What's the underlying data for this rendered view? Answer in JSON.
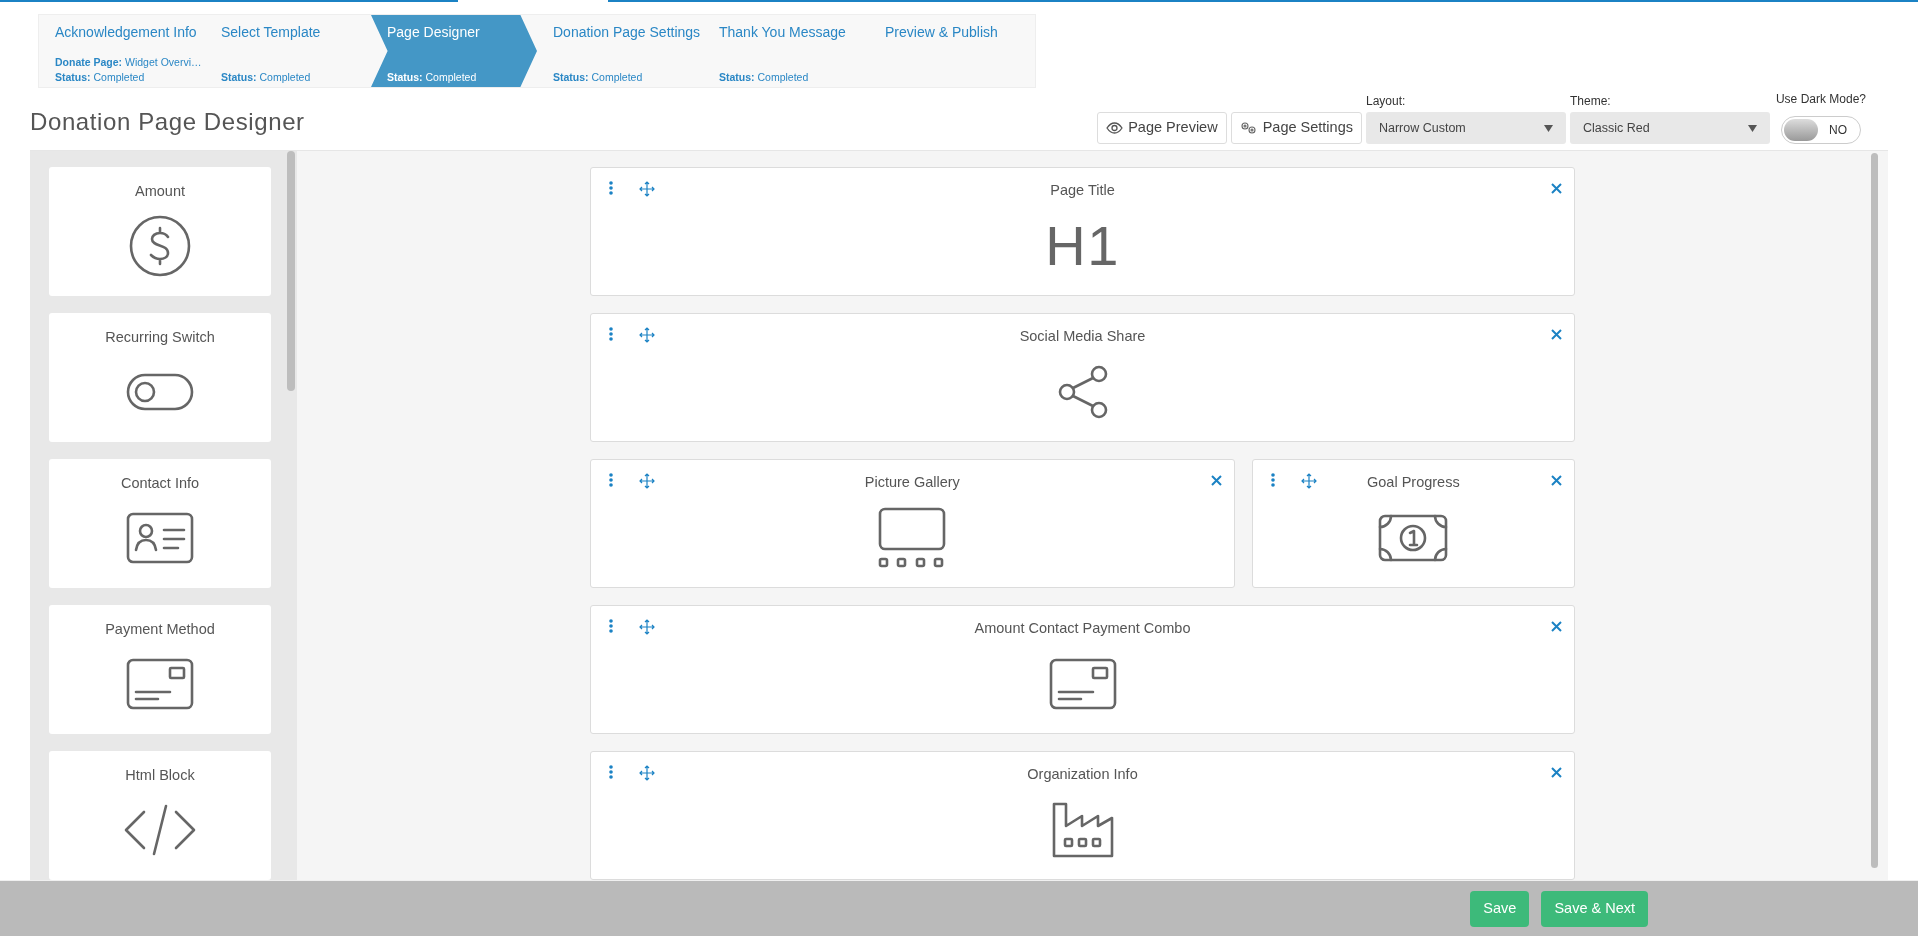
{
  "steps": [
    {
      "title": "Acknowledgement Info",
      "detail_label": "Donate Page:",
      "detail_value": "Widget Overvi…",
      "status_label": "Status:",
      "status_value": "Completed",
      "selected": false
    },
    {
      "title": "Select Template",
      "status_label": "Status:",
      "status_value": "Completed",
      "selected": false
    },
    {
      "title": "Page Designer",
      "status_label": "Status:",
      "status_value": "Completed",
      "selected": true
    },
    {
      "title": "Donation Page Settings",
      "status_label": "Status:",
      "status_value": "Completed",
      "selected": false
    },
    {
      "title": "Thank You Message",
      "status_label": "Status:",
      "status_value": "Completed",
      "selected": false
    },
    {
      "title": "Preview & Publish",
      "selected": false
    }
  ],
  "page_title": "Donation Page Designer",
  "toolbar": {
    "preview_button": "Page Preview",
    "settings_button": "Page Settings",
    "layout": {
      "label": "Layout:",
      "value": "Narrow Custom"
    },
    "theme": {
      "label": "Theme:",
      "value": "Classic Red"
    },
    "dark_mode": {
      "label": "Use Dark Mode?",
      "on": false,
      "state_text": "NO"
    }
  },
  "palette": [
    {
      "title": "Amount",
      "kind": "dollar"
    },
    {
      "title": "Recurring Switch",
      "kind": "toggle"
    },
    {
      "title": "Contact Info",
      "kind": "contact"
    },
    {
      "title": "Payment Method",
      "kind": "card"
    },
    {
      "title": "Html Block",
      "kind": "code"
    }
  ],
  "canvas_rows": [
    [
      {
        "title": "Page Title",
        "kind": "text",
        "text": "H1"
      }
    ],
    [
      {
        "title": "Social Media Share",
        "kind": "share"
      }
    ],
    [
      {
        "title": "Picture Gallery",
        "kind": "gallery"
      },
      {
        "title": "Goal Progress",
        "kind": "money"
      }
    ],
    [
      {
        "title": "Amount Contact Payment Combo",
        "kind": "card"
      }
    ],
    [
      {
        "title": "Organization Info",
        "kind": "factory"
      }
    ]
  ],
  "footer": {
    "save": "Save",
    "save_next": "Save & Next"
  }
}
